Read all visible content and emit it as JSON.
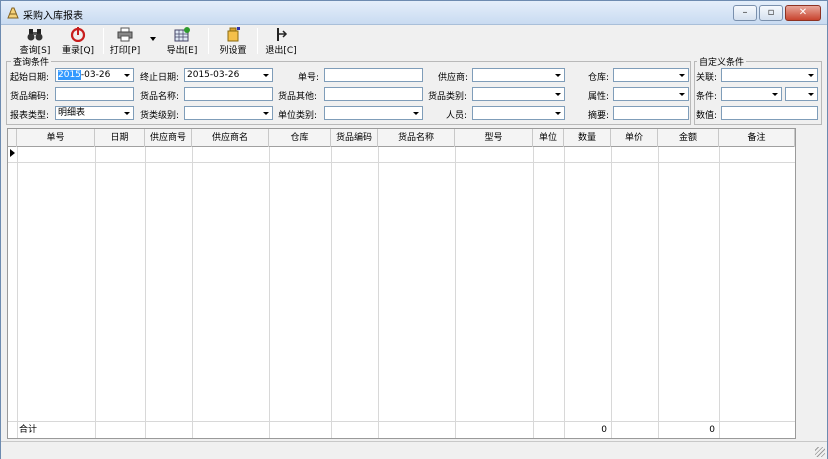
{
  "window": {
    "title": "采购入库报表"
  },
  "toolbar": {
    "query": "查询[S]",
    "reset": "重录[Q]",
    "print": "打印[P]",
    "export": "导出[E]",
    "columns": "列设置",
    "exit": "退出[C]"
  },
  "query_group": {
    "legend": "查询条件",
    "start_date_label": "起始日期:",
    "start_date_selected": "2015",
    "start_date_rest": "-03-26",
    "end_date_label": "终止日期:",
    "end_date_value": "2015-03-26",
    "order_no_label": "单号:",
    "supplier_label": "供应商:",
    "warehouse_label": "仓库:",
    "item_code_label": "货品编码:",
    "item_name_label": "货品名称:",
    "item_other_label": "货品其他:",
    "item_category_label": "货品类别:",
    "attribute_label": "属性:",
    "report_type_label": "报表类型:",
    "report_type_value": "明细表",
    "category_level_label": "货类级别:",
    "unit_category_label": "单位类别:",
    "staff_label": "人员:",
    "summary_label": "摘要:"
  },
  "custom_group": {
    "legend": "自定义条件",
    "relation_label": "关联:",
    "condition_label": "条件:",
    "value_label": "数值:"
  },
  "grid": {
    "columns": [
      "单号",
      "日期",
      "供应商号",
      "供应商名",
      "仓库",
      "货品编码",
      "货品名称",
      "型号",
      "单位",
      "数量",
      "单价",
      "金额",
      "备注"
    ],
    "total_label": "合计",
    "total_quantity": "0",
    "total_amount": "0"
  },
  "colors": {
    "title_bar": "#c9dbf1",
    "selection": "#3399ff",
    "close_button": "#c8432e"
  }
}
